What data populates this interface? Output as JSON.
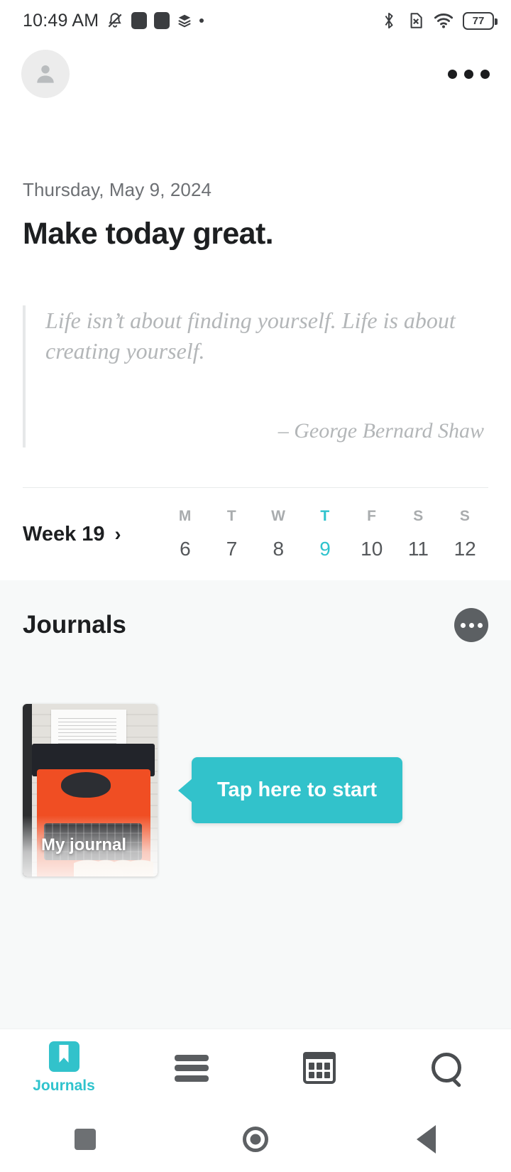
{
  "status_bar": {
    "time": "10:49 AM",
    "battery_percent": "77",
    "icons": [
      "mute-bell-icon",
      "square-icon",
      "square-icon",
      "layers-icon",
      "dot-icon",
      "bluetooth-icon",
      "no-sim-icon",
      "wifi-icon",
      "battery-icon"
    ]
  },
  "app_bar": {
    "avatar_icon": "person-avatar-icon",
    "overflow_icon": "more-horizontal-icon"
  },
  "hero": {
    "date": "Thursday, May 9, 2024",
    "greeting": "Make today great."
  },
  "quote": {
    "text": "Life isn’t about finding yourself. Life is about creating yourself.",
    "author": "– George Bernard Shaw"
  },
  "week": {
    "label": "Week 19",
    "chevron": "›",
    "days": [
      {
        "dow": "M",
        "num": "6",
        "today": false
      },
      {
        "dow": "T",
        "num": "7",
        "today": false
      },
      {
        "dow": "W",
        "num": "8",
        "today": false
      },
      {
        "dow": "T",
        "num": "9",
        "today": true
      },
      {
        "dow": "F",
        "num": "10",
        "today": false
      },
      {
        "dow": "S",
        "num": "11",
        "today": false
      },
      {
        "dow": "S",
        "num": "12",
        "today": false
      }
    ]
  },
  "journals": {
    "title": "Journals",
    "more_icon": "more-horizontal-circle-icon",
    "card": {
      "label": "My journal",
      "cover_icon": "typewriter-photo"
    },
    "tooltip": {
      "text": "Tap here to start"
    }
  },
  "bottom_nav": [
    {
      "label": "Journals",
      "icon": "bookmark-icon",
      "active": true
    },
    {
      "label": "",
      "icon": "menu-icon",
      "active": false
    },
    {
      "label": "",
      "icon": "calendar-icon",
      "active": false
    },
    {
      "label": "",
      "icon": "search-icon",
      "active": false
    }
  ],
  "system_bar": {
    "recent_icon": "square-recents-icon",
    "home_icon": "circle-home-icon",
    "back_icon": "triangle-back-icon"
  },
  "colors": {
    "accent": "#32c2cb",
    "text_primary": "#1d1f21",
    "text_muted": "#b3b6b8",
    "section_bg": "#f7f9f9"
  }
}
